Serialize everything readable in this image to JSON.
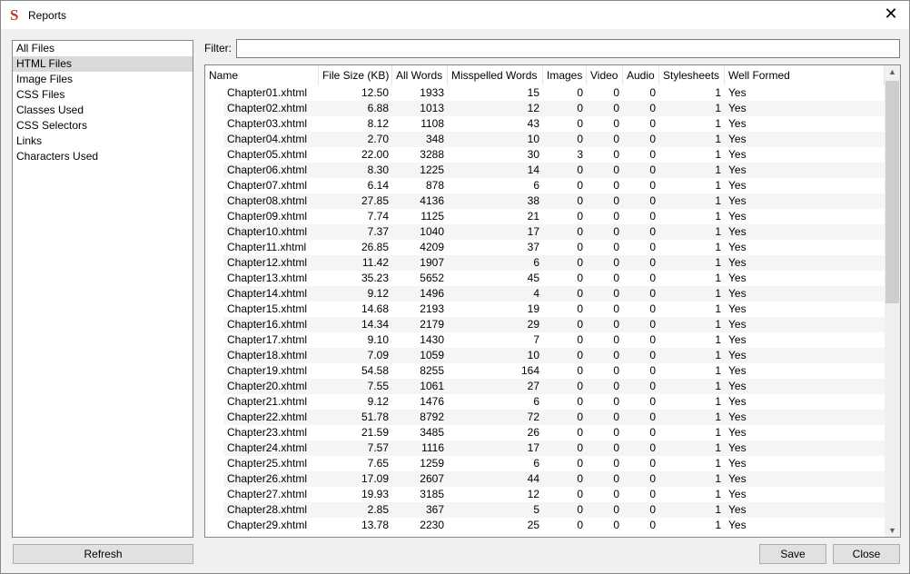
{
  "window": {
    "title": "Reports",
    "app_icon": "S"
  },
  "sidebar": {
    "items": [
      "All Files",
      "HTML Files",
      "Image Files",
      "CSS Files",
      "Classes Used",
      "CSS Selectors",
      "Links",
      "Characters Used"
    ],
    "selected": 1
  },
  "buttons": {
    "refresh": "Refresh",
    "save": "Save",
    "close": "Close"
  },
  "filter": {
    "label": "Filter:",
    "value": ""
  },
  "table": {
    "columns": [
      "Name",
      "File Size (KB)",
      "All Words",
      "Misspelled Words",
      "Images",
      "Video",
      "Audio",
      "Stylesheets",
      "Well Formed"
    ],
    "rows": [
      [
        "Chapter01.xhtml",
        "12.50",
        "1933",
        "15",
        "0",
        "0",
        "0",
        "1",
        "Yes"
      ],
      [
        "Chapter02.xhtml",
        "6.88",
        "1013",
        "12",
        "0",
        "0",
        "0",
        "1",
        "Yes"
      ],
      [
        "Chapter03.xhtml",
        "8.12",
        "1108",
        "43",
        "0",
        "0",
        "0",
        "1",
        "Yes"
      ],
      [
        "Chapter04.xhtml",
        "2.70",
        "348",
        "10",
        "0",
        "0",
        "0",
        "1",
        "Yes"
      ],
      [
        "Chapter05.xhtml",
        "22.00",
        "3288",
        "30",
        "3",
        "0",
        "0",
        "1",
        "Yes"
      ],
      [
        "Chapter06.xhtml",
        "8.30",
        "1225",
        "14",
        "0",
        "0",
        "0",
        "1",
        "Yes"
      ],
      [
        "Chapter07.xhtml",
        "6.14",
        "878",
        "6",
        "0",
        "0",
        "0",
        "1",
        "Yes"
      ],
      [
        "Chapter08.xhtml",
        "27.85",
        "4136",
        "38",
        "0",
        "0",
        "0",
        "1",
        "Yes"
      ],
      [
        "Chapter09.xhtml",
        "7.74",
        "1125",
        "21",
        "0",
        "0",
        "0",
        "1",
        "Yes"
      ],
      [
        "Chapter10.xhtml",
        "7.37",
        "1040",
        "17",
        "0",
        "0",
        "0",
        "1",
        "Yes"
      ],
      [
        "Chapter11.xhtml",
        "26.85",
        "4209",
        "37",
        "0",
        "0",
        "0",
        "1",
        "Yes"
      ],
      [
        "Chapter12.xhtml",
        "11.42",
        "1907",
        "6",
        "0",
        "0",
        "0",
        "1",
        "Yes"
      ],
      [
        "Chapter13.xhtml",
        "35.23",
        "5652",
        "45",
        "0",
        "0",
        "0",
        "1",
        "Yes"
      ],
      [
        "Chapter14.xhtml",
        "9.12",
        "1496",
        "4",
        "0",
        "0",
        "0",
        "1",
        "Yes"
      ],
      [
        "Chapter15.xhtml",
        "14.68",
        "2193",
        "19",
        "0",
        "0",
        "0",
        "1",
        "Yes"
      ],
      [
        "Chapter16.xhtml",
        "14.34",
        "2179",
        "29",
        "0",
        "0",
        "0",
        "1",
        "Yes"
      ],
      [
        "Chapter17.xhtml",
        "9.10",
        "1430",
        "7",
        "0",
        "0",
        "0",
        "1",
        "Yes"
      ],
      [
        "Chapter18.xhtml",
        "7.09",
        "1059",
        "10",
        "0",
        "0",
        "0",
        "1",
        "Yes"
      ],
      [
        "Chapter19.xhtml",
        "54.58",
        "8255",
        "164",
        "0",
        "0",
        "0",
        "1",
        "Yes"
      ],
      [
        "Chapter20.xhtml",
        "7.55",
        "1061",
        "27",
        "0",
        "0",
        "0",
        "1",
        "Yes"
      ],
      [
        "Chapter21.xhtml",
        "9.12",
        "1476",
        "6",
        "0",
        "0",
        "0",
        "1",
        "Yes"
      ],
      [
        "Chapter22.xhtml",
        "51.78",
        "8792",
        "72",
        "0",
        "0",
        "0",
        "1",
        "Yes"
      ],
      [
        "Chapter23.xhtml",
        "21.59",
        "3485",
        "26",
        "0",
        "0",
        "0",
        "1",
        "Yes"
      ],
      [
        "Chapter24.xhtml",
        "7.57",
        "1116",
        "17",
        "0",
        "0",
        "0",
        "1",
        "Yes"
      ],
      [
        "Chapter25.xhtml",
        "7.65",
        "1259",
        "6",
        "0",
        "0",
        "0",
        "1",
        "Yes"
      ],
      [
        "Chapter26.xhtml",
        "17.09",
        "2607",
        "44",
        "0",
        "0",
        "0",
        "1",
        "Yes"
      ],
      [
        "Chapter27.xhtml",
        "19.93",
        "3185",
        "12",
        "0",
        "0",
        "0",
        "1",
        "Yes"
      ],
      [
        "Chapter28.xhtml",
        "2.85",
        "367",
        "5",
        "0",
        "0",
        "0",
        "1",
        "Yes"
      ],
      [
        "Chapter29.xhtml",
        "13.78",
        "2230",
        "25",
        "0",
        "0",
        "0",
        "1",
        "Yes"
      ]
    ]
  }
}
